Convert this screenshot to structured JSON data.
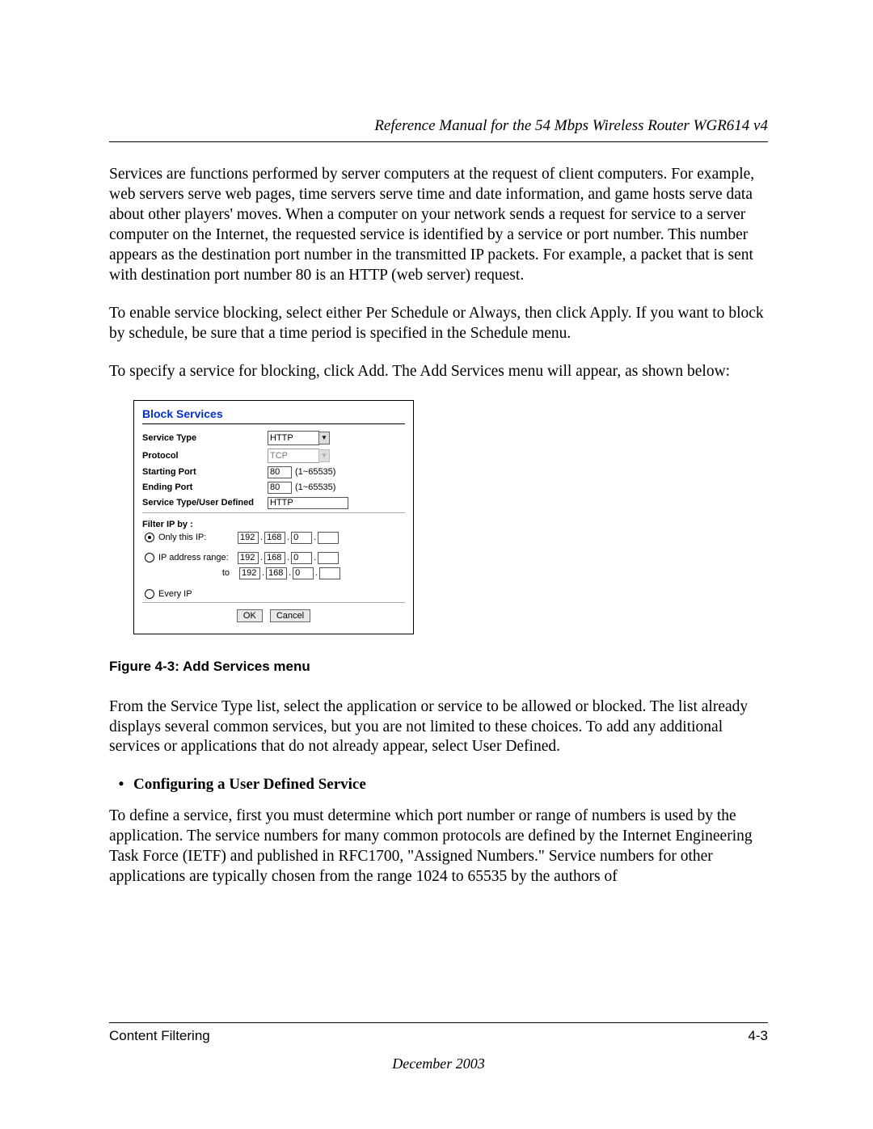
{
  "header": {
    "title": "Reference Manual for the 54 Mbps Wireless Router WGR614 v4"
  },
  "p1": "Services are functions performed by server computers at the request of client computers. For example, web servers serve web pages, time servers serve time and date information, and game hosts serve data about other players' moves. When a computer on your network sends a request for service to a server computer on the Internet, the requested service is identified by a service or port number. This number appears as the destination port number in the transmitted IP packets. For example, a packet that is sent with destination port number 80 is an HTTP (web server) request.",
  "p2": "To enable service blocking, select either Per Schedule or Always, then click Apply. If you want to block by schedule, be sure that a time period is specified in the Schedule menu.",
  "p3": "To specify a service for blocking, click Add. The Add Services menu will appear, as shown below:",
  "panel": {
    "title": "Block Services",
    "rows": {
      "service_type": {
        "label": "Service Type",
        "value": "HTTP"
      },
      "protocol": {
        "label": "Protocol",
        "value": "TCP"
      },
      "starting_port": {
        "label": "Starting Port",
        "value": "80",
        "hint": "(1~65535)"
      },
      "ending_port": {
        "label": "Ending Port",
        "value": "80",
        "hint": "(1~65535)"
      },
      "user_defined": {
        "label": "Service Type/User Defined",
        "value": "HTTP"
      }
    },
    "filter": {
      "title": "Filter IP by :",
      "only_label": "Only this IP:",
      "range_label": "IP address range:",
      "to_label": "to",
      "every_label": "Every IP",
      "only_ip": [
        "192",
        "168",
        "0",
        ""
      ],
      "range_from": [
        "192",
        "168",
        "0",
        ""
      ],
      "range_to": [
        "192",
        "168",
        "0",
        ""
      ]
    },
    "buttons": {
      "ok": "OK",
      "cancel": "Cancel"
    }
  },
  "figure_caption": "Figure 4-3:  Add Services menu",
  "p4": "From the Service Type list, select the application or service to be allowed or blocked. The list already displays several common services, but you are not limited to these choices. To add any additional services or applications that do not already appear, select User Defined.",
  "bullet_heading": "Configuring a User Defined Service",
  "p5": "To define a service, first you must determine which port number or range of numbers is used by the application. The service numbers for many common protocols are defined by the Internet Engineering Task Force (IETF) and published in RFC1700, \"Assigned Numbers.\" Service numbers for other applications are typically chosen from the range 1024 to 65535 by the authors of",
  "footer": {
    "section": "Content Filtering",
    "page_num": "4-3",
    "date": "December 2003"
  }
}
